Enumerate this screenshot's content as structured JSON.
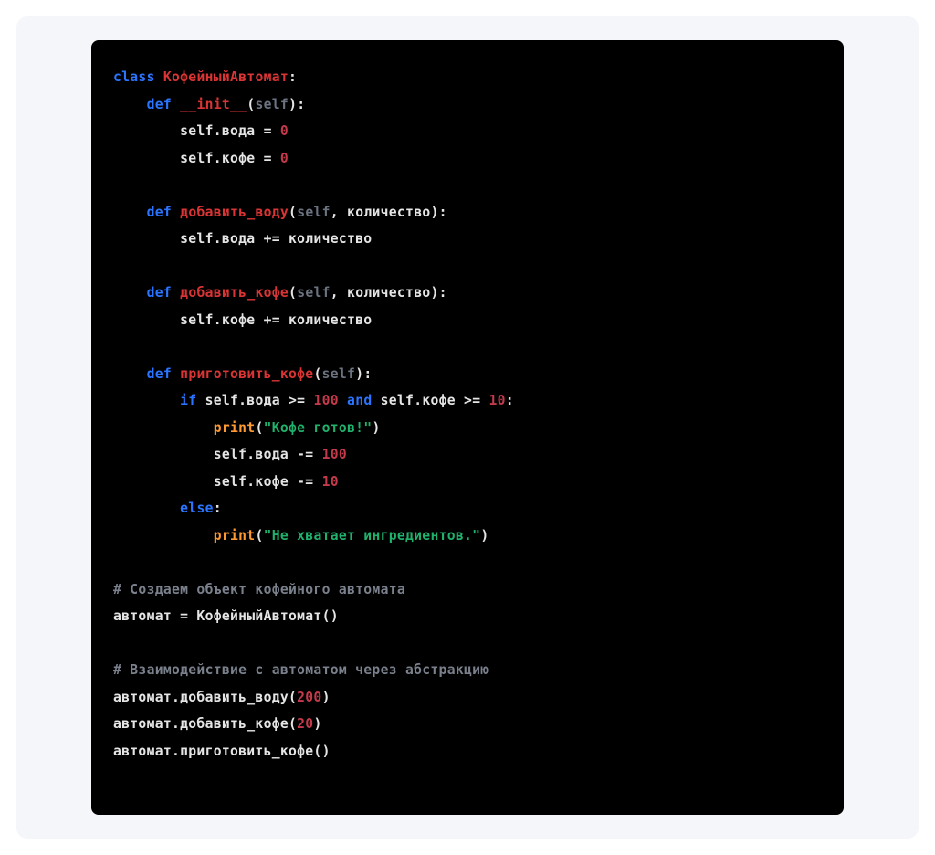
{
  "code": {
    "tokens": [
      {
        "cls": "tk-kw",
        "t": "class"
      },
      {
        "cls": "tk-plain",
        "t": " "
      },
      {
        "cls": "tk-cls",
        "t": "КофейныйАвтомат"
      },
      {
        "cls": "tk-plain",
        "t": ":"
      },
      {
        "nl": true
      },
      {
        "cls": "tk-plain",
        "t": "    "
      },
      {
        "cls": "tk-kw",
        "t": "def"
      },
      {
        "cls": "tk-plain",
        "t": " "
      },
      {
        "cls": "tk-cls",
        "t": "__init__"
      },
      {
        "cls": "tk-plain",
        "t": "("
      },
      {
        "cls": "tk-self",
        "t": "self"
      },
      {
        "cls": "tk-plain",
        "t": "):"
      },
      {
        "nl": true
      },
      {
        "cls": "tk-plain",
        "t": "        self.вода = "
      },
      {
        "cls": "tk-num",
        "t": "0"
      },
      {
        "nl": true
      },
      {
        "cls": "tk-plain",
        "t": "        self.кофе = "
      },
      {
        "cls": "tk-num",
        "t": "0"
      },
      {
        "nl": true
      },
      {
        "nl": true
      },
      {
        "cls": "tk-plain",
        "t": "    "
      },
      {
        "cls": "tk-kw",
        "t": "def"
      },
      {
        "cls": "tk-plain",
        "t": " "
      },
      {
        "cls": "tk-cls",
        "t": "добавить_воду"
      },
      {
        "cls": "tk-plain",
        "t": "("
      },
      {
        "cls": "tk-self",
        "t": "self"
      },
      {
        "cls": "tk-plain",
        "t": ", количество):"
      },
      {
        "nl": true
      },
      {
        "cls": "tk-plain",
        "t": "        self.вода += количество"
      },
      {
        "nl": true
      },
      {
        "nl": true
      },
      {
        "cls": "tk-plain",
        "t": "    "
      },
      {
        "cls": "tk-kw",
        "t": "def"
      },
      {
        "cls": "tk-plain",
        "t": " "
      },
      {
        "cls": "tk-cls",
        "t": "добавить_кофе"
      },
      {
        "cls": "tk-plain",
        "t": "("
      },
      {
        "cls": "tk-self",
        "t": "self"
      },
      {
        "cls": "tk-plain",
        "t": ", количество):"
      },
      {
        "nl": true
      },
      {
        "cls": "tk-plain",
        "t": "        self.кофе += количество"
      },
      {
        "nl": true
      },
      {
        "nl": true
      },
      {
        "cls": "tk-plain",
        "t": "    "
      },
      {
        "cls": "tk-kw",
        "t": "def"
      },
      {
        "cls": "tk-plain",
        "t": " "
      },
      {
        "cls": "tk-cls",
        "t": "приготовить_кофе"
      },
      {
        "cls": "tk-plain",
        "t": "("
      },
      {
        "cls": "tk-self",
        "t": "self"
      },
      {
        "cls": "tk-plain",
        "t": "):"
      },
      {
        "nl": true
      },
      {
        "cls": "tk-plain",
        "t": "        "
      },
      {
        "cls": "tk-kw",
        "t": "if"
      },
      {
        "cls": "tk-plain",
        "t": " self.вода >= "
      },
      {
        "cls": "tk-num",
        "t": "100"
      },
      {
        "cls": "tk-plain",
        "t": " "
      },
      {
        "cls": "tk-kw",
        "t": "and"
      },
      {
        "cls": "tk-plain",
        "t": " self.кофе >= "
      },
      {
        "cls": "tk-num",
        "t": "10"
      },
      {
        "cls": "tk-plain",
        "t": ":"
      },
      {
        "nl": true
      },
      {
        "cls": "tk-plain",
        "t": "            "
      },
      {
        "cls": "tk-builtin",
        "t": "print"
      },
      {
        "cls": "tk-plain",
        "t": "("
      },
      {
        "cls": "tk-str",
        "t": "\"Кофе готов!\""
      },
      {
        "cls": "tk-plain",
        "t": ")"
      },
      {
        "nl": true
      },
      {
        "cls": "tk-plain",
        "t": "            self.вода -= "
      },
      {
        "cls": "tk-num",
        "t": "100"
      },
      {
        "nl": true
      },
      {
        "cls": "tk-plain",
        "t": "            self.кофе -= "
      },
      {
        "cls": "tk-num",
        "t": "10"
      },
      {
        "nl": true
      },
      {
        "cls": "tk-plain",
        "t": "        "
      },
      {
        "cls": "tk-kw",
        "t": "else"
      },
      {
        "cls": "tk-plain",
        "t": ":"
      },
      {
        "nl": true
      },
      {
        "cls": "tk-plain",
        "t": "            "
      },
      {
        "cls": "tk-builtin",
        "t": "print"
      },
      {
        "cls": "tk-plain",
        "t": "("
      },
      {
        "cls": "tk-str",
        "t": "\"Не хватает ингредиентов.\""
      },
      {
        "cls": "tk-plain",
        "t": ")"
      },
      {
        "nl": true
      },
      {
        "nl": true
      },
      {
        "cls": "tk-comm",
        "t": "# Создаем объект кофейного автомата"
      },
      {
        "nl": true
      },
      {
        "cls": "tk-plain",
        "t": "автомат = КофейныйАвтомат()"
      },
      {
        "nl": true
      },
      {
        "nl": true
      },
      {
        "cls": "tk-comm",
        "t": "# Взаимодействие с автоматом через абстракцию"
      },
      {
        "nl": true
      },
      {
        "cls": "tk-plain",
        "t": "автомат.добавить_воду("
      },
      {
        "cls": "tk-num",
        "t": "200"
      },
      {
        "cls": "tk-plain",
        "t": ")"
      },
      {
        "nl": true
      },
      {
        "cls": "tk-plain",
        "t": "автомат.добавить_кофе("
      },
      {
        "cls": "tk-num",
        "t": "20"
      },
      {
        "cls": "tk-plain",
        "t": ")"
      },
      {
        "nl": true
      },
      {
        "cls": "tk-plain",
        "t": "автомат.приготовить_кофе()"
      }
    ]
  }
}
